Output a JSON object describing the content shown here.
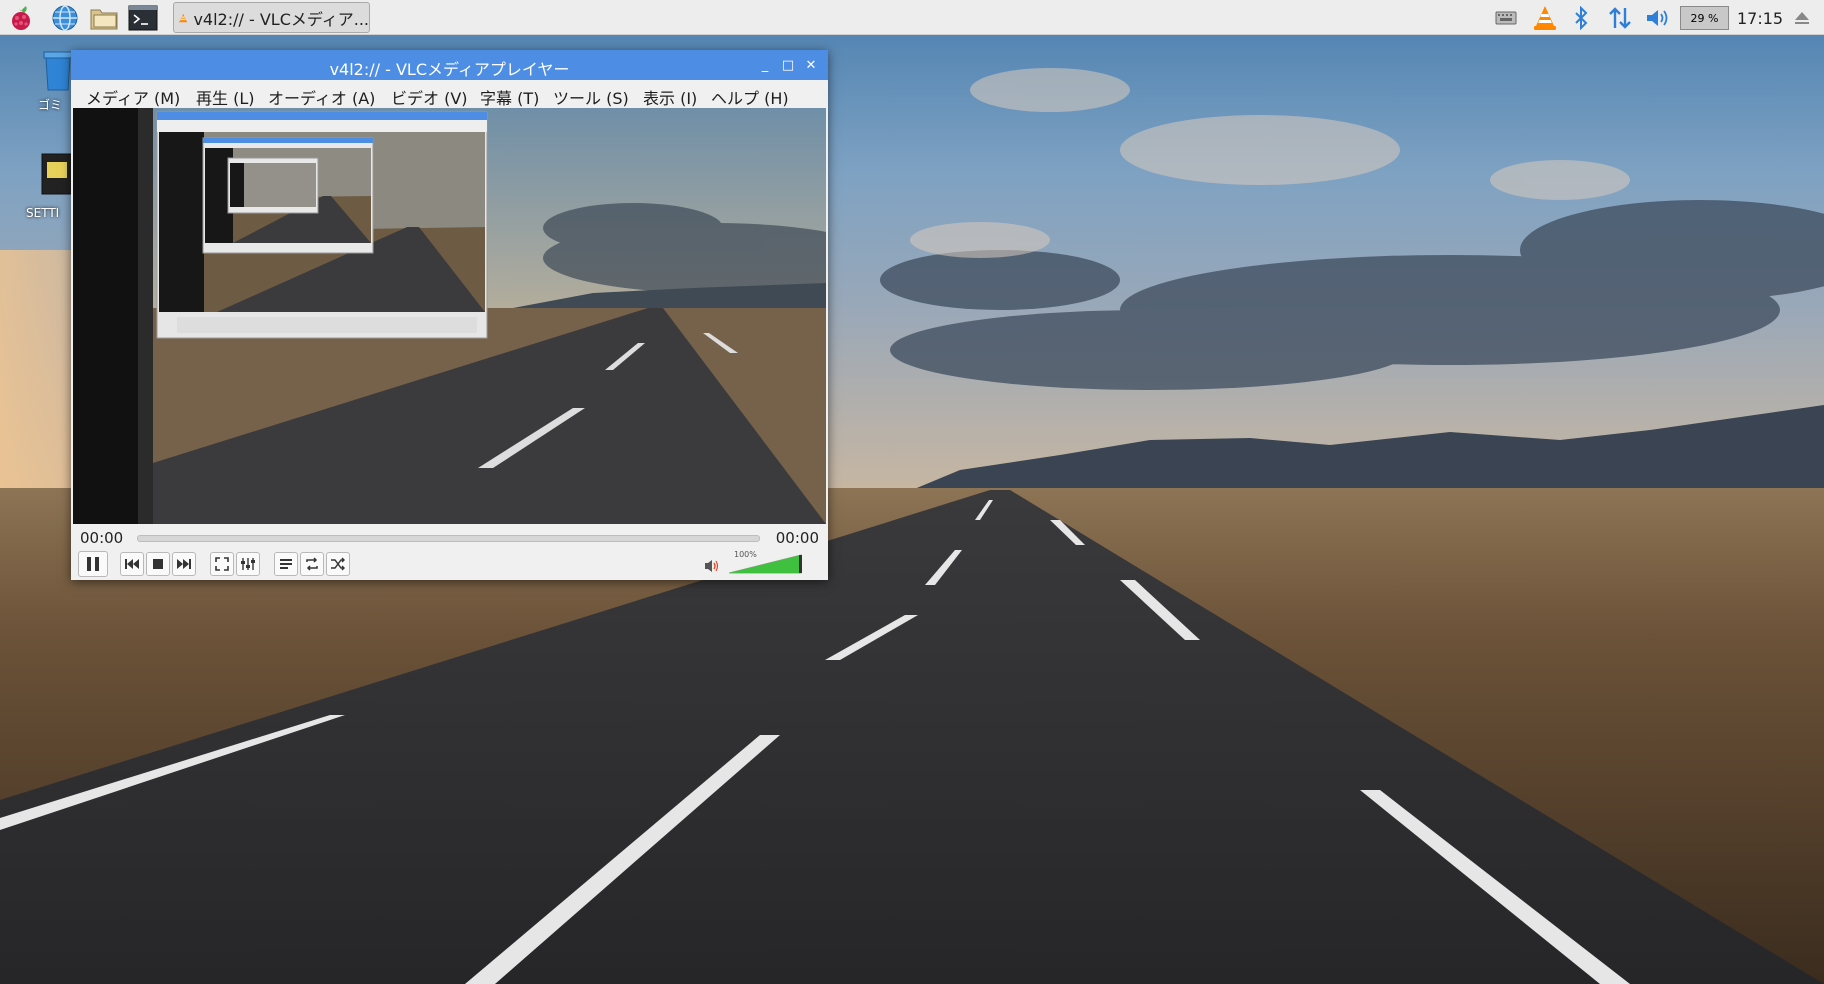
{
  "taskbar": {
    "icons": [
      "raspberry-menu-icon",
      "web-browser-icon",
      "file-manager-icon",
      "terminal-icon"
    ],
    "tasks": [
      {
        "icon": "vlc-cone-icon",
        "label": "v4l2:// - VLCメディア..."
      }
    ],
    "tray": {
      "icons": [
        "keyboard-icon",
        "vlc-tray-icon",
        "bluetooth-icon",
        "network-icon",
        "volume-icon",
        "eject-icon"
      ],
      "cpu": "29 %",
      "clock": "17:15"
    }
  },
  "desktop": {
    "icons": [
      {
        "icon": "trash-icon",
        "label": "ゴミ"
      },
      {
        "icon": "sd-card-icon",
        "label": "SETTI"
      }
    ]
  },
  "vlc": {
    "title": "v4l2:// - VLCメディアプレイヤー",
    "window_controls": {
      "minimize": "_",
      "maximize": "□",
      "close": "✕"
    },
    "menu": [
      "メディア (M)",
      "再生 (L)",
      "オーディオ (A)",
      "ビデオ (V)",
      "字幕 (T)",
      "ツール (S)",
      "表示 (I)",
      "ヘルプ (H)"
    ],
    "time_elapsed": "00:00",
    "time_total": "00:00",
    "seek_position": 0,
    "volume": {
      "level": 100,
      "label": "100%"
    },
    "controls": [
      "pause-icon",
      "previous-icon",
      "stop-icon",
      "next-icon",
      "fullscreen-icon",
      "extended-settings-icon",
      "playlist-icon",
      "loop-icon",
      "shuffle-icon"
    ],
    "colors": {
      "titlebar": "#4d8de4",
      "volume_fill": "#3fc03f"
    }
  }
}
